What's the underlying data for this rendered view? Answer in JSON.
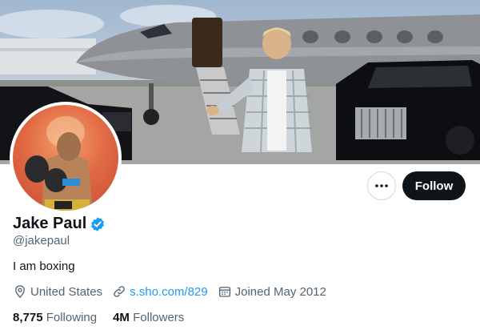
{
  "profile": {
    "name": "Jake Paul",
    "handle": "@jakepaul",
    "bio": "I am boxing",
    "verified": true
  },
  "meta": {
    "location": "United States",
    "link": "s.sho.com/829",
    "joined": "Joined May 2012"
  },
  "stats": {
    "following_count": "8,775",
    "following_label": "Following",
    "followers_count": "4M",
    "followers_label": "Followers"
  },
  "actions": {
    "follow_label": "Follow",
    "more_label": "More"
  },
  "colors": {
    "accent": "#1d9bf0",
    "primary_text": "#0f1419",
    "secondary_text": "#536471",
    "follow_bg": "#0f1419"
  },
  "icons": {
    "verified": "verified-badge-icon",
    "more": "more-dots-icon",
    "location": "location-pin-icon",
    "link": "link-icon",
    "calendar": "calendar-icon"
  }
}
